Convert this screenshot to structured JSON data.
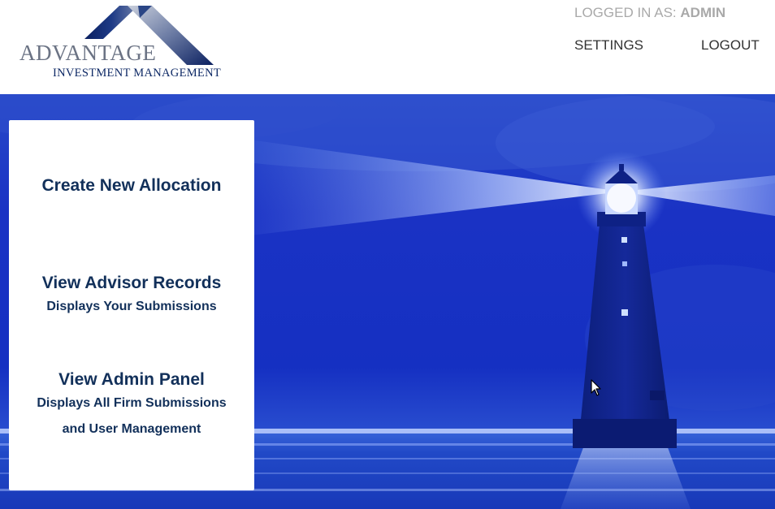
{
  "header": {
    "logo": {
      "word": "ADVANTAGE",
      "subtitle": "INVESTMENT MANAGEMENT"
    },
    "login_status": {
      "prefix": "LOGGED IN AS:",
      "user": "ADMIN"
    },
    "nav": {
      "settings": "SETTINGS",
      "logout": "LOGOUT"
    }
  },
  "menu": {
    "create": {
      "title": "Create New Allocation"
    },
    "advisor": {
      "title": "View Advisor Records",
      "description": "Displays Your Submissions"
    },
    "admin": {
      "title": "View Admin Panel",
      "description_line1": "Displays All Firm Submissions",
      "description_line2": "and User Management"
    }
  },
  "hero": {
    "image": "lighthouse-at-sea",
    "colors": {
      "sky": "#1a34c4",
      "sea": "#1e45c8",
      "beam": "#dfe9ff",
      "tower": "#0d1f80"
    }
  },
  "colors": {
    "brand_navy": "#12305a",
    "muted_gray": "#a9a9a9"
  }
}
